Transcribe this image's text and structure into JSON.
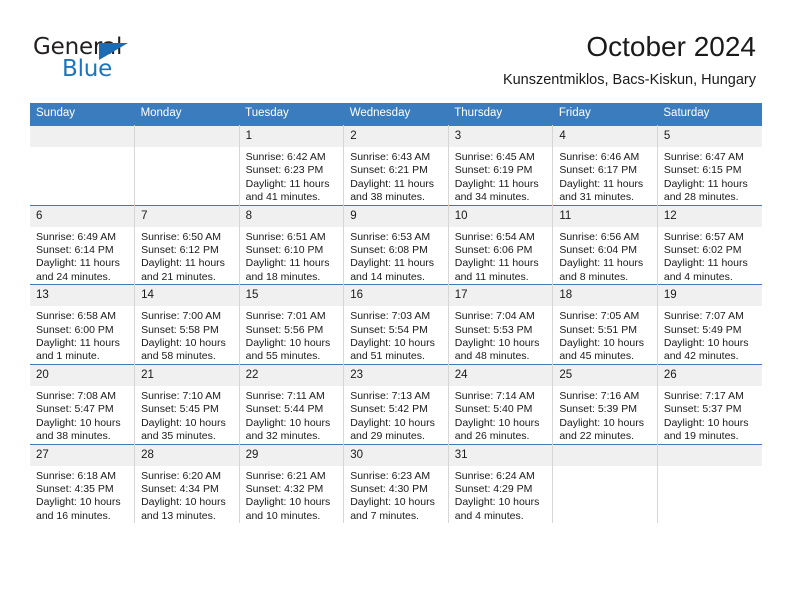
{
  "brand": {
    "name_top": "General",
    "name_bottom": "Blue",
    "triangle_color": "#1b6cb5",
    "blue_color": "#1b75bc"
  },
  "header": {
    "title": "October 2024",
    "subtitle": "Kunszentmiklos, Bacs-Kiskun, Hungary"
  },
  "theme": {
    "header_blue": "#3a7cbe",
    "daynum_band": "#f0f0f0",
    "cell_border": "#d6d6d6"
  },
  "weekdays": [
    "Sunday",
    "Monday",
    "Tuesday",
    "Wednesday",
    "Thursday",
    "Friday",
    "Saturday"
  ],
  "weeks": [
    [
      {
        "day": "",
        "sunrise": "",
        "sunset": "",
        "daylight": ""
      },
      {
        "day": "",
        "sunrise": "",
        "sunset": "",
        "daylight": ""
      },
      {
        "day": "1",
        "sunrise": "Sunrise: 6:42 AM",
        "sunset": "Sunset: 6:23 PM",
        "daylight": "Daylight: 11 hours and 41 minutes."
      },
      {
        "day": "2",
        "sunrise": "Sunrise: 6:43 AM",
        "sunset": "Sunset: 6:21 PM",
        "daylight": "Daylight: 11 hours and 38 minutes."
      },
      {
        "day": "3",
        "sunrise": "Sunrise: 6:45 AM",
        "sunset": "Sunset: 6:19 PM",
        "daylight": "Daylight: 11 hours and 34 minutes."
      },
      {
        "day": "4",
        "sunrise": "Sunrise: 6:46 AM",
        "sunset": "Sunset: 6:17 PM",
        "daylight": "Daylight: 11 hours and 31 minutes."
      },
      {
        "day": "5",
        "sunrise": "Sunrise: 6:47 AM",
        "sunset": "Sunset: 6:15 PM",
        "daylight": "Daylight: 11 hours and 28 minutes."
      }
    ],
    [
      {
        "day": "6",
        "sunrise": "Sunrise: 6:49 AM",
        "sunset": "Sunset: 6:14 PM",
        "daylight": "Daylight: 11 hours and 24 minutes."
      },
      {
        "day": "7",
        "sunrise": "Sunrise: 6:50 AM",
        "sunset": "Sunset: 6:12 PM",
        "daylight": "Daylight: 11 hours and 21 minutes."
      },
      {
        "day": "8",
        "sunrise": "Sunrise: 6:51 AM",
        "sunset": "Sunset: 6:10 PM",
        "daylight": "Daylight: 11 hours and 18 minutes."
      },
      {
        "day": "9",
        "sunrise": "Sunrise: 6:53 AM",
        "sunset": "Sunset: 6:08 PM",
        "daylight": "Daylight: 11 hours and 14 minutes."
      },
      {
        "day": "10",
        "sunrise": "Sunrise: 6:54 AM",
        "sunset": "Sunset: 6:06 PM",
        "daylight": "Daylight: 11 hours and 11 minutes."
      },
      {
        "day": "11",
        "sunrise": "Sunrise: 6:56 AM",
        "sunset": "Sunset: 6:04 PM",
        "daylight": "Daylight: 11 hours and 8 minutes."
      },
      {
        "day": "12",
        "sunrise": "Sunrise: 6:57 AM",
        "sunset": "Sunset: 6:02 PM",
        "daylight": "Daylight: 11 hours and 4 minutes."
      }
    ],
    [
      {
        "day": "13",
        "sunrise": "Sunrise: 6:58 AM",
        "sunset": "Sunset: 6:00 PM",
        "daylight": "Daylight: 11 hours and 1 minute."
      },
      {
        "day": "14",
        "sunrise": "Sunrise: 7:00 AM",
        "sunset": "Sunset: 5:58 PM",
        "daylight": "Daylight: 10 hours and 58 minutes."
      },
      {
        "day": "15",
        "sunrise": "Sunrise: 7:01 AM",
        "sunset": "Sunset: 5:56 PM",
        "daylight": "Daylight: 10 hours and 55 minutes."
      },
      {
        "day": "16",
        "sunrise": "Sunrise: 7:03 AM",
        "sunset": "Sunset: 5:54 PM",
        "daylight": "Daylight: 10 hours and 51 minutes."
      },
      {
        "day": "17",
        "sunrise": "Sunrise: 7:04 AM",
        "sunset": "Sunset: 5:53 PM",
        "daylight": "Daylight: 10 hours and 48 minutes."
      },
      {
        "day": "18",
        "sunrise": "Sunrise: 7:05 AM",
        "sunset": "Sunset: 5:51 PM",
        "daylight": "Daylight: 10 hours and 45 minutes."
      },
      {
        "day": "19",
        "sunrise": "Sunrise: 7:07 AM",
        "sunset": "Sunset: 5:49 PM",
        "daylight": "Daylight: 10 hours and 42 minutes."
      }
    ],
    [
      {
        "day": "20",
        "sunrise": "Sunrise: 7:08 AM",
        "sunset": "Sunset: 5:47 PM",
        "daylight": "Daylight: 10 hours and 38 minutes."
      },
      {
        "day": "21",
        "sunrise": "Sunrise: 7:10 AM",
        "sunset": "Sunset: 5:45 PM",
        "daylight": "Daylight: 10 hours and 35 minutes."
      },
      {
        "day": "22",
        "sunrise": "Sunrise: 7:11 AM",
        "sunset": "Sunset: 5:44 PM",
        "daylight": "Daylight: 10 hours and 32 minutes."
      },
      {
        "day": "23",
        "sunrise": "Sunrise: 7:13 AM",
        "sunset": "Sunset: 5:42 PM",
        "daylight": "Daylight: 10 hours and 29 minutes."
      },
      {
        "day": "24",
        "sunrise": "Sunrise: 7:14 AM",
        "sunset": "Sunset: 5:40 PM",
        "daylight": "Daylight: 10 hours and 26 minutes."
      },
      {
        "day": "25",
        "sunrise": "Sunrise: 7:16 AM",
        "sunset": "Sunset: 5:39 PM",
        "daylight": "Daylight: 10 hours and 22 minutes."
      },
      {
        "day": "26",
        "sunrise": "Sunrise: 7:17 AM",
        "sunset": "Sunset: 5:37 PM",
        "daylight": "Daylight: 10 hours and 19 minutes."
      }
    ],
    [
      {
        "day": "27",
        "sunrise": "Sunrise: 6:18 AM",
        "sunset": "Sunset: 4:35 PM",
        "daylight": "Daylight: 10 hours and 16 minutes."
      },
      {
        "day": "28",
        "sunrise": "Sunrise: 6:20 AM",
        "sunset": "Sunset: 4:34 PM",
        "daylight": "Daylight: 10 hours and 13 minutes."
      },
      {
        "day": "29",
        "sunrise": "Sunrise: 6:21 AM",
        "sunset": "Sunset: 4:32 PM",
        "daylight": "Daylight: 10 hours and 10 minutes."
      },
      {
        "day": "30",
        "sunrise": "Sunrise: 6:23 AM",
        "sunset": "Sunset: 4:30 PM",
        "daylight": "Daylight: 10 hours and 7 minutes."
      },
      {
        "day": "31",
        "sunrise": "Sunrise: 6:24 AM",
        "sunset": "Sunset: 4:29 PM",
        "daylight": "Daylight: 10 hours and 4 minutes."
      },
      {
        "day": "",
        "sunrise": "",
        "sunset": "",
        "daylight": ""
      },
      {
        "day": "",
        "sunrise": "",
        "sunset": "",
        "daylight": ""
      }
    ]
  ]
}
